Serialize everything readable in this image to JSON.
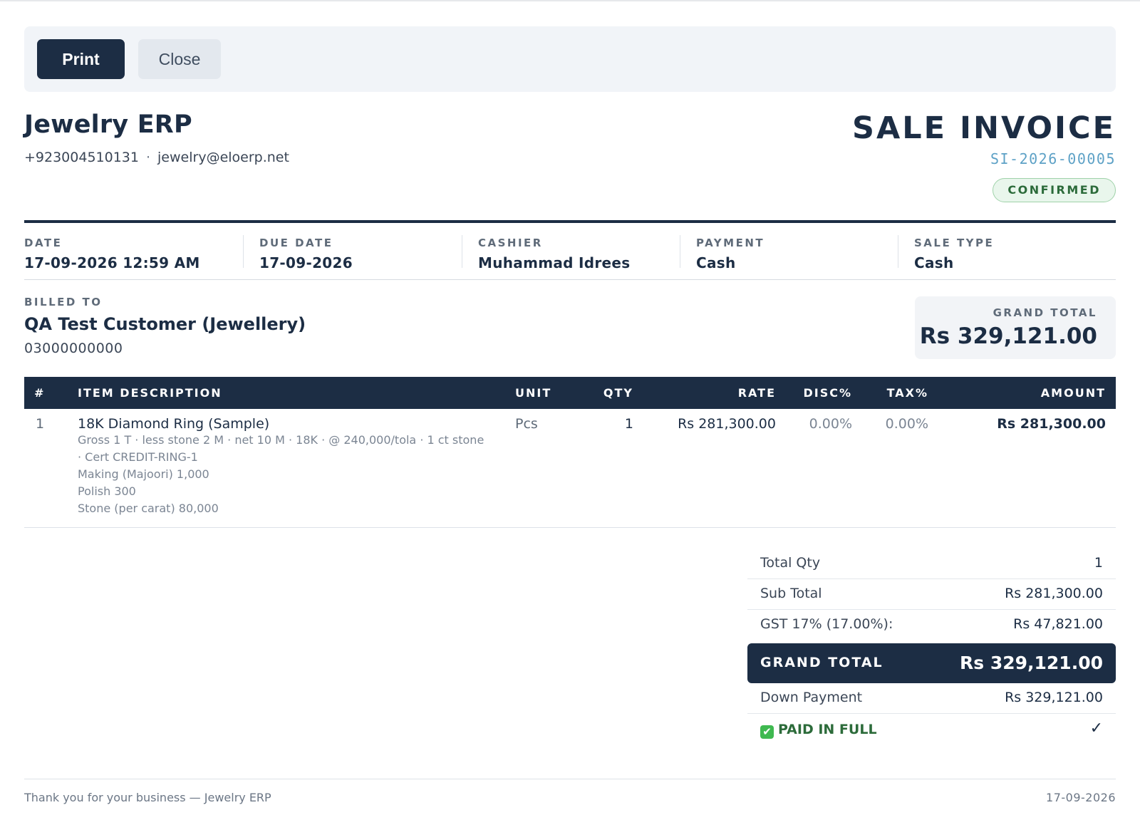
{
  "toolbar": {
    "print_label": "Print",
    "close_label": "Close"
  },
  "company": {
    "name": "Jewelry ERP",
    "phone": "+923004510131",
    "separator": "·",
    "email": "jewelry@eloerp.net"
  },
  "document": {
    "title": "SALE INVOICE",
    "number": "SI-2026-00005",
    "status": "CONFIRMED"
  },
  "meta": [
    {
      "label": "DATE",
      "value": "17-09-2026 12:59 AM"
    },
    {
      "label": "DUE DATE",
      "value": "17-09-2026"
    },
    {
      "label": "CASHIER",
      "value": "Muhammad Idrees"
    },
    {
      "label": "PAYMENT",
      "value": "Cash"
    },
    {
      "label": "SALE TYPE",
      "value": "Cash"
    }
  ],
  "billed_to": {
    "label": "BILLED TO",
    "name": "QA Test Customer (Jewellery)",
    "phone": "03000000000"
  },
  "grand_total_box": {
    "label": "GRAND TOTAL",
    "value": "Rs 329,121.00"
  },
  "items": {
    "headers": [
      "#",
      "ITEM DESCRIPTION",
      "UNIT",
      "QTY",
      "RATE",
      "DISC%",
      "TAX%",
      "AMOUNT"
    ],
    "rows": [
      {
        "index": "1",
        "title": "18K Diamond Ring (Sample)",
        "details": [
          "Gross 1 T · less stone 2 M · net 10 M · 18K · @ 240,000/tola · 1 ct stone",
          "· Cert CREDIT-RING-1",
          "Making (Majoori) 1,000",
          "Polish 300",
          "Stone (per carat) 80,000"
        ],
        "unit": "Pcs",
        "qty": "1",
        "rate": "Rs 281,300.00",
        "disc": "0.00%",
        "tax": "0.00%",
        "amount": "Rs 281,300.00"
      }
    ]
  },
  "totals": {
    "total_qty_label": "Total Qty",
    "total_qty": "1",
    "sub_total_label": "Sub Total",
    "sub_total": "Rs 281,300.00",
    "gst_label": "GST 17% (17.00%):",
    "gst": "Rs 47,821.00",
    "grand_total_label": "GRAND TOTAL",
    "grand_total": "Rs 329,121.00",
    "down_payment_label": "Down Payment",
    "down_payment": "Rs 329,121.00",
    "paid_label": "PAID IN FULL",
    "paid_check": "✓",
    "paid_icon": "white-check-mark-icon"
  },
  "footer": {
    "left": "Thank you for your business — Jewelry ERP",
    "right": "17-09-2026"
  },
  "colors": {
    "navy": "#1c2d44",
    "accent_blue": "#5da1c6",
    "success_green": "#2c6b3a",
    "badge_bg": "#e9f6ec"
  }
}
